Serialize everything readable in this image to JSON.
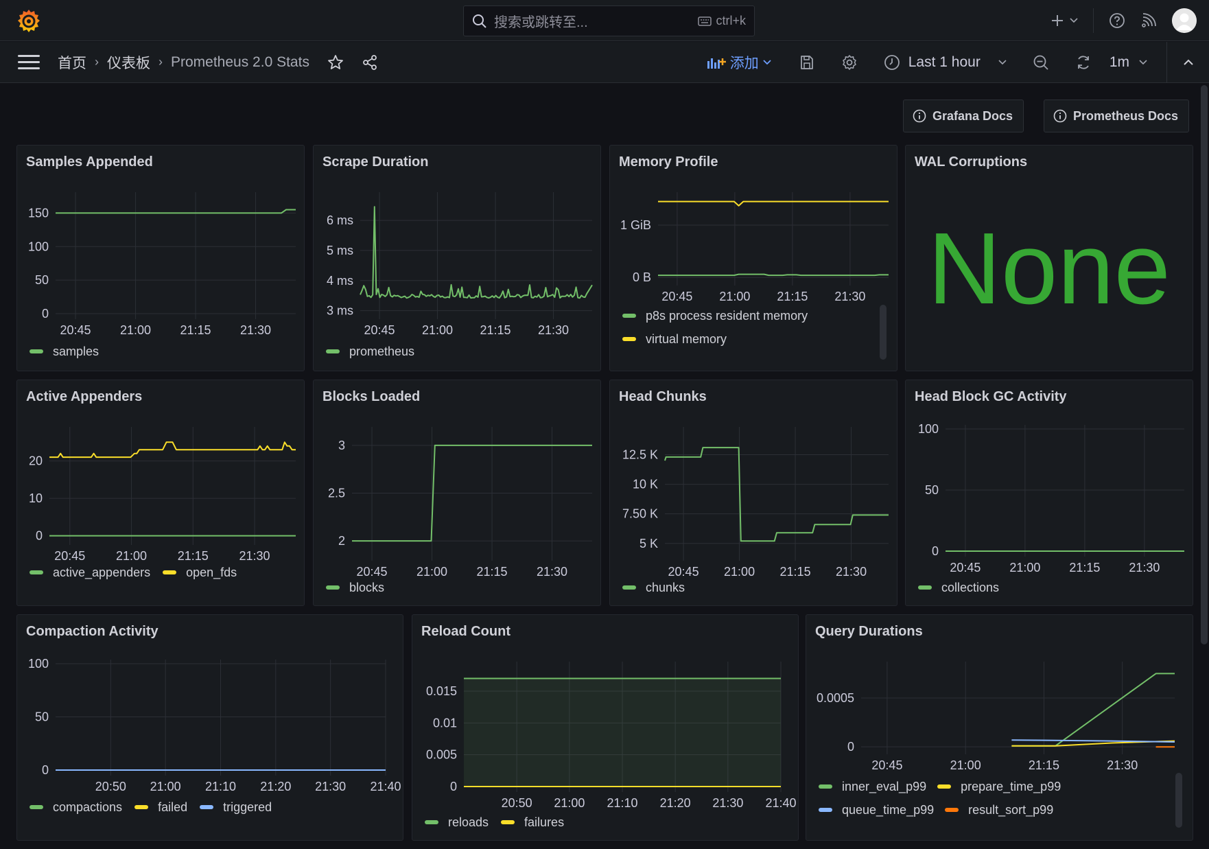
{
  "topbar": {
    "search_placeholder": "搜索或跳转至...",
    "search_shortcut": "ctrl+k",
    "icons": [
      "grafana-logo",
      "search-icon",
      "keyboard-icon",
      "plus-icon",
      "chevron-down-icon",
      "help-icon",
      "news-rss-icon",
      "user-avatar"
    ]
  },
  "navbar": {
    "breadcrumb": [
      "首页",
      "仪表板",
      "Prometheus 2.0 Stats"
    ],
    "add_label": "添加",
    "time_range": "Last 1 hour",
    "refresh_interval": "1m"
  },
  "links": [
    {
      "label": "Grafana Docs"
    },
    {
      "label": "Prometheus Docs"
    }
  ],
  "colors": {
    "green": "#73bf69",
    "yellow": "#fade2a",
    "blue": "#8ab8ff",
    "orange": "#ff780a",
    "stat_green": "#37a834",
    "accent": "#6e9fff"
  },
  "panels": {
    "wal": {
      "title": "WAL Corruptions",
      "value": "None"
    }
  },
  "chart_data": [
    {
      "id": "samples",
      "type": "line",
      "title": "Samples Appended",
      "x_ticks": [
        "20:45",
        "21:00",
        "21:15",
        "21:30"
      ],
      "x_range": [
        "20:40",
        "21:40"
      ],
      "y_ticks": [
        "0",
        "50",
        "100",
        "150"
      ],
      "ylim": [
        0,
        175
      ],
      "series": [
        {
          "name": "samples",
          "color": "green",
          "points": [
            [
              0,
              150
            ],
            [
              0.94,
              150
            ],
            [
              0.96,
              155
            ],
            [
              1.0,
              155
            ]
          ]
        }
      ]
    },
    {
      "id": "scrape",
      "type": "line",
      "title": "Scrape Duration",
      "x_ticks": [
        "20:45",
        "21:00",
        "21:15",
        "21:30"
      ],
      "y_ticks": [
        "3 ms",
        "4 ms",
        "5 ms",
        "6 ms"
      ],
      "ylim": [
        2.9,
        6.8
      ],
      "series": [
        {
          "name": "prometheus",
          "color": "green",
          "noisy": true,
          "base": 3.48,
          "spike_at": 0.06,
          "spike_value": 6.45,
          "end_value": 3.85
        }
      ]
    },
    {
      "id": "memory",
      "type": "line",
      "title": "Memory Profile",
      "x_ticks": [
        "20:45",
        "21:00",
        "21:15",
        "21:30"
      ],
      "y_ticks": [
        "0 B",
        "1 GiB"
      ],
      "ylim": [
        -0.05,
        1.55
      ],
      "series": [
        {
          "name": "p8s process resident memory",
          "color": "green",
          "points": [
            [
              0,
              0.04
            ],
            [
              0.33,
              0.04
            ],
            [
              0.35,
              0.06
            ],
            [
              0.46,
              0.06
            ],
            [
              0.48,
              0.04
            ],
            [
              0.54,
              0.04
            ],
            [
              0.56,
              0.05
            ],
            [
              0.6,
              0.05
            ],
            [
              0.62,
              0.04
            ],
            [
              0.94,
              0.04
            ],
            [
              0.96,
              0.05
            ],
            [
              1.0,
              0.05
            ]
          ]
        },
        {
          "name": "virtual memory",
          "color": "yellow",
          "points": [
            [
              0,
              1.45
            ],
            [
              0.33,
              1.45
            ],
            [
              0.35,
              1.37
            ],
            [
              0.37,
              1.45
            ],
            [
              1.0,
              1.45
            ]
          ]
        }
      ]
    },
    {
      "id": "appenders",
      "type": "line",
      "title": "Active Appenders",
      "x_ticks": [
        "20:45",
        "21:00",
        "21:15",
        "21:30"
      ],
      "y_ticks": [
        "0",
        "10",
        "20"
      ],
      "ylim": [
        -1,
        28
      ],
      "series": [
        {
          "name": "active_appenders",
          "color": "green",
          "points": [
            [
              0,
              0
            ],
            [
              1,
              0
            ]
          ]
        },
        {
          "name": "open_fds",
          "color": "yellow",
          "points": [
            [
              0,
              21
            ],
            [
              0.035,
              21
            ],
            [
              0.045,
              22
            ],
            [
              0.055,
              21
            ],
            [
              0.17,
              21
            ],
            [
              0.18,
              22
            ],
            [
              0.19,
              21
            ],
            [
              0.33,
              21
            ],
            [
              0.345,
              22
            ],
            [
              0.355,
              22
            ],
            [
              0.365,
              23
            ],
            [
              0.46,
              23
            ],
            [
              0.475,
              25
            ],
            [
              0.5,
              25
            ],
            [
              0.515,
              23
            ],
            [
              0.845,
              23
            ],
            [
              0.855,
              24
            ],
            [
              0.865,
              23
            ],
            [
              0.875,
              23
            ],
            [
              0.885,
              24
            ],
            [
              0.895,
              23
            ],
            [
              0.945,
              23
            ],
            [
              0.955,
              25
            ],
            [
              0.965,
              24
            ],
            [
              0.975,
              24
            ],
            [
              0.985,
              23
            ],
            [
              1.0,
              23
            ]
          ]
        }
      ]
    },
    {
      "id": "blocks",
      "type": "line",
      "title": "Blocks Loaded",
      "x_ticks": [
        "20:45",
        "21:00",
        "21:15",
        "21:30"
      ],
      "y_ticks": [
        "2",
        "2.5",
        "3"
      ],
      "ylim": [
        1.85,
        3.15
      ],
      "series": [
        {
          "name": "blocks",
          "color": "green",
          "points": [
            [
              0,
              2
            ],
            [
              0.33,
              2
            ],
            [
              0.345,
              3
            ],
            [
              1,
              3
            ]
          ]
        }
      ]
    },
    {
      "id": "chunks",
      "type": "line",
      "title": "Head Chunks",
      "x_ticks": [
        "20:45",
        "21:00",
        "21:15",
        "21:30"
      ],
      "y_ticks": [
        "5 K",
        "7.50 K",
        "10 K",
        "12.5 K"
      ],
      "ylim": [
        4000,
        14500
      ],
      "series": [
        {
          "name": "chunks",
          "color": "green",
          "points": [
            [
              0,
              12000
            ],
            [
              0.005,
              12300
            ],
            [
              0.16,
              12300
            ],
            [
              0.17,
              13100
            ],
            [
              0.33,
              13100
            ],
            [
              0.34,
              5200
            ],
            [
              0.49,
              5200
            ],
            [
              0.5,
              5900
            ],
            [
              0.66,
              5900
            ],
            [
              0.67,
              6600
            ],
            [
              0.83,
              6600
            ],
            [
              0.84,
              7400
            ],
            [
              1.0,
              7400
            ]
          ]
        }
      ]
    },
    {
      "id": "gc",
      "type": "line",
      "title": "Head Block GC Activity",
      "x_ticks": [
        "20:45",
        "21:00",
        "21:15",
        "21:30"
      ],
      "y_ticks": [
        "0",
        "50",
        "100"
      ],
      "ylim": [
        0,
        100
      ],
      "series": [
        {
          "name": "collections",
          "color": "green",
          "points": [
            [
              0,
              0
            ],
            [
              1,
              0
            ]
          ]
        }
      ]
    },
    {
      "id": "compaction",
      "type": "line",
      "title": "Compaction Activity",
      "x_ticks": [
        "20:50",
        "21:00",
        "21:10",
        "21:20",
        "21:30",
        "21:40"
      ],
      "y_ticks": [
        "0",
        "50",
        "100"
      ],
      "ylim": [
        0,
        100
      ],
      "series": [
        {
          "name": "compactions",
          "color": "green",
          "points": [
            [
              0,
              0
            ],
            [
              1,
              0
            ]
          ]
        },
        {
          "name": "failed",
          "color": "yellow",
          "points": [
            [
              0,
              0
            ],
            [
              1,
              0
            ]
          ]
        },
        {
          "name": "triggered",
          "color": "blue",
          "points": [
            [
              0,
              0
            ],
            [
              1,
              0
            ]
          ]
        }
      ]
    },
    {
      "id": "reload",
      "type": "area",
      "title": "Reload Count",
      "x_ticks": [
        "20:50",
        "21:00",
        "21:10",
        "21:20",
        "21:30",
        "21:40"
      ],
      "y_ticks": [
        "0",
        "0.005",
        "0.01",
        "0.015"
      ],
      "ylim": [
        0,
        0.019
      ],
      "series": [
        {
          "name": "reloads",
          "color": "green",
          "fill": true,
          "points": [
            [
              0,
              0.017
            ],
            [
              1,
              0.017
            ]
          ]
        },
        {
          "name": "failures",
          "color": "yellow",
          "points": [
            [
              0,
              0
            ],
            [
              1,
              0
            ]
          ]
        }
      ]
    },
    {
      "id": "query",
      "type": "line",
      "title": "Query Durations",
      "x_ticks": [
        "20:45",
        "21:00",
        "21:15",
        "21:30"
      ],
      "y_ticks": [
        "0",
        "0.0005"
      ],
      "ylim": [
        -2e-05,
        0.00083
      ],
      "series": [
        {
          "name": "inner_eval_p99",
          "color": "green",
          "points": [
            [
              0.48,
              1e-05
            ],
            [
              0.62,
              1e-05
            ],
            [
              0.94,
              0.00075
            ],
            [
              1.0,
              0.00075
            ]
          ]
        },
        {
          "name": "prepare_time_p99",
          "color": "yellow",
          "points": [
            [
              0.48,
              1e-05
            ],
            [
              0.62,
              1e-05
            ],
            [
              0.8,
              4e-05
            ],
            [
              1.0,
              6e-05
            ]
          ]
        },
        {
          "name": "queue_time_p99",
          "color": "blue",
          "points": [
            [
              0.48,
              7e-05
            ],
            [
              0.8,
              6e-05
            ],
            [
              1.0,
              5e-05
            ]
          ]
        },
        {
          "name": "result_sort_p99",
          "color": "orange",
          "points": [
            [
              0.94,
              0.0
            ],
            [
              1.0,
              0.0
            ]
          ]
        }
      ]
    }
  ]
}
